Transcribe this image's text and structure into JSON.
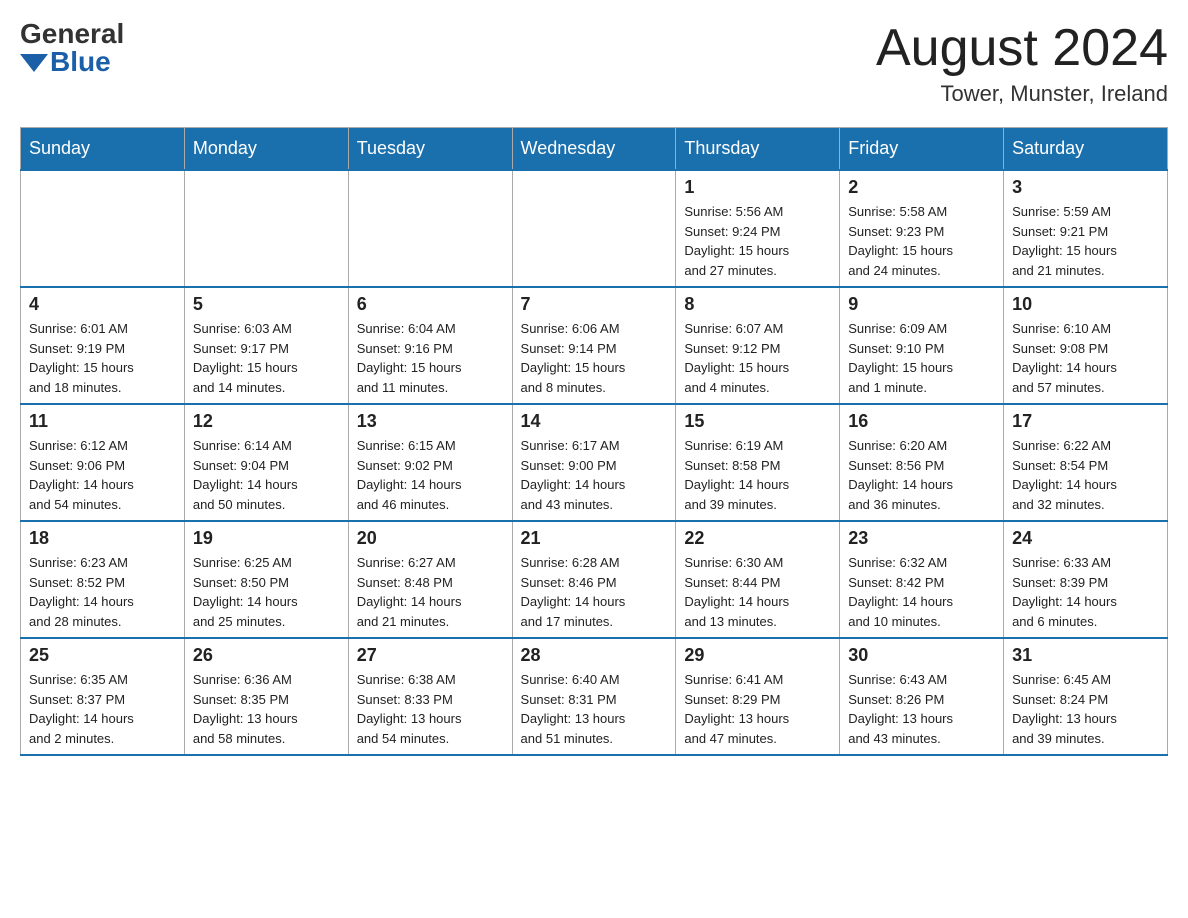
{
  "header": {
    "logo_general": "General",
    "logo_blue": "Blue",
    "month_title": "August 2024",
    "location": "Tower, Munster, Ireland"
  },
  "days_of_week": [
    "Sunday",
    "Monday",
    "Tuesday",
    "Wednesday",
    "Thursday",
    "Friday",
    "Saturday"
  ],
  "weeks": [
    [
      {
        "day": "",
        "info": ""
      },
      {
        "day": "",
        "info": ""
      },
      {
        "day": "",
        "info": ""
      },
      {
        "day": "",
        "info": ""
      },
      {
        "day": "1",
        "info": "Sunrise: 5:56 AM\nSunset: 9:24 PM\nDaylight: 15 hours\nand 27 minutes."
      },
      {
        "day": "2",
        "info": "Sunrise: 5:58 AM\nSunset: 9:23 PM\nDaylight: 15 hours\nand 24 minutes."
      },
      {
        "day": "3",
        "info": "Sunrise: 5:59 AM\nSunset: 9:21 PM\nDaylight: 15 hours\nand 21 minutes."
      }
    ],
    [
      {
        "day": "4",
        "info": "Sunrise: 6:01 AM\nSunset: 9:19 PM\nDaylight: 15 hours\nand 18 minutes."
      },
      {
        "day": "5",
        "info": "Sunrise: 6:03 AM\nSunset: 9:17 PM\nDaylight: 15 hours\nand 14 minutes."
      },
      {
        "day": "6",
        "info": "Sunrise: 6:04 AM\nSunset: 9:16 PM\nDaylight: 15 hours\nand 11 minutes."
      },
      {
        "day": "7",
        "info": "Sunrise: 6:06 AM\nSunset: 9:14 PM\nDaylight: 15 hours\nand 8 minutes."
      },
      {
        "day": "8",
        "info": "Sunrise: 6:07 AM\nSunset: 9:12 PM\nDaylight: 15 hours\nand 4 minutes."
      },
      {
        "day": "9",
        "info": "Sunrise: 6:09 AM\nSunset: 9:10 PM\nDaylight: 15 hours\nand 1 minute."
      },
      {
        "day": "10",
        "info": "Sunrise: 6:10 AM\nSunset: 9:08 PM\nDaylight: 14 hours\nand 57 minutes."
      }
    ],
    [
      {
        "day": "11",
        "info": "Sunrise: 6:12 AM\nSunset: 9:06 PM\nDaylight: 14 hours\nand 54 minutes."
      },
      {
        "day": "12",
        "info": "Sunrise: 6:14 AM\nSunset: 9:04 PM\nDaylight: 14 hours\nand 50 minutes."
      },
      {
        "day": "13",
        "info": "Sunrise: 6:15 AM\nSunset: 9:02 PM\nDaylight: 14 hours\nand 46 minutes."
      },
      {
        "day": "14",
        "info": "Sunrise: 6:17 AM\nSunset: 9:00 PM\nDaylight: 14 hours\nand 43 minutes."
      },
      {
        "day": "15",
        "info": "Sunrise: 6:19 AM\nSunset: 8:58 PM\nDaylight: 14 hours\nand 39 minutes."
      },
      {
        "day": "16",
        "info": "Sunrise: 6:20 AM\nSunset: 8:56 PM\nDaylight: 14 hours\nand 36 minutes."
      },
      {
        "day": "17",
        "info": "Sunrise: 6:22 AM\nSunset: 8:54 PM\nDaylight: 14 hours\nand 32 minutes."
      }
    ],
    [
      {
        "day": "18",
        "info": "Sunrise: 6:23 AM\nSunset: 8:52 PM\nDaylight: 14 hours\nand 28 minutes."
      },
      {
        "day": "19",
        "info": "Sunrise: 6:25 AM\nSunset: 8:50 PM\nDaylight: 14 hours\nand 25 minutes."
      },
      {
        "day": "20",
        "info": "Sunrise: 6:27 AM\nSunset: 8:48 PM\nDaylight: 14 hours\nand 21 minutes."
      },
      {
        "day": "21",
        "info": "Sunrise: 6:28 AM\nSunset: 8:46 PM\nDaylight: 14 hours\nand 17 minutes."
      },
      {
        "day": "22",
        "info": "Sunrise: 6:30 AM\nSunset: 8:44 PM\nDaylight: 14 hours\nand 13 minutes."
      },
      {
        "day": "23",
        "info": "Sunrise: 6:32 AM\nSunset: 8:42 PM\nDaylight: 14 hours\nand 10 minutes."
      },
      {
        "day": "24",
        "info": "Sunrise: 6:33 AM\nSunset: 8:39 PM\nDaylight: 14 hours\nand 6 minutes."
      }
    ],
    [
      {
        "day": "25",
        "info": "Sunrise: 6:35 AM\nSunset: 8:37 PM\nDaylight: 14 hours\nand 2 minutes."
      },
      {
        "day": "26",
        "info": "Sunrise: 6:36 AM\nSunset: 8:35 PM\nDaylight: 13 hours\nand 58 minutes."
      },
      {
        "day": "27",
        "info": "Sunrise: 6:38 AM\nSunset: 8:33 PM\nDaylight: 13 hours\nand 54 minutes."
      },
      {
        "day": "28",
        "info": "Sunrise: 6:40 AM\nSunset: 8:31 PM\nDaylight: 13 hours\nand 51 minutes."
      },
      {
        "day": "29",
        "info": "Sunrise: 6:41 AM\nSunset: 8:29 PM\nDaylight: 13 hours\nand 47 minutes."
      },
      {
        "day": "30",
        "info": "Sunrise: 6:43 AM\nSunset: 8:26 PM\nDaylight: 13 hours\nand 43 minutes."
      },
      {
        "day": "31",
        "info": "Sunrise: 6:45 AM\nSunset: 8:24 PM\nDaylight: 13 hours\nand 39 minutes."
      }
    ]
  ]
}
